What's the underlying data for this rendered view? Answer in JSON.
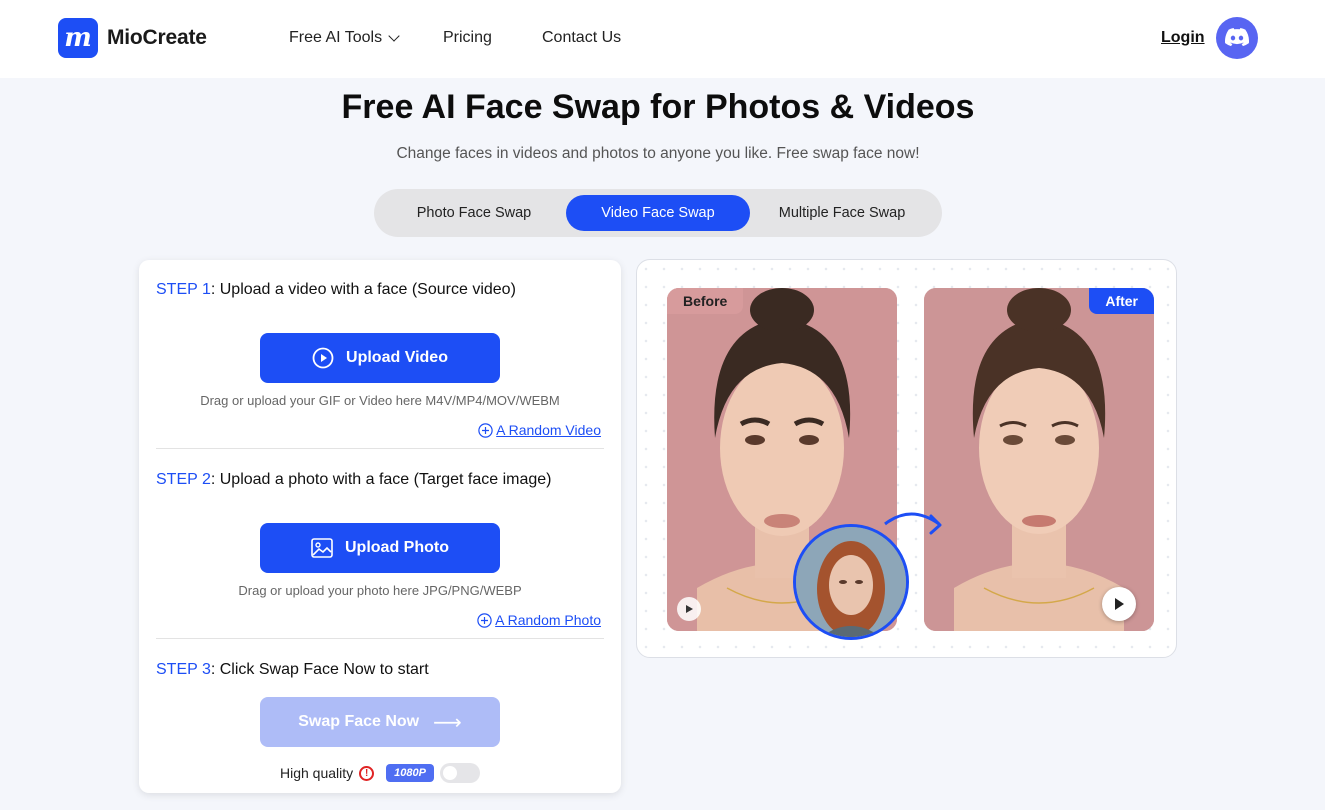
{
  "header": {
    "brand": "MioCreate",
    "logo_letter": "m",
    "nav": [
      "Free AI Tools",
      "Pricing",
      "Contact Us"
    ],
    "login": "Login",
    "discord_icon": "discord-icon"
  },
  "hero": {
    "title": "Free AI Face Swap for Photos & Videos",
    "subtitle": "Change faces in videos and photos to anyone you like. Free swap face now!"
  },
  "tabs": {
    "items": [
      "Photo Face Swap",
      "Video Face Swap",
      "Multiple Face Swap"
    ],
    "active": "Video Face Swap"
  },
  "panel": {
    "step1": {
      "num": "STEP 1",
      "text": ": Upload a video with a face (Source video)",
      "button": "Upload Video",
      "hint": "Drag or upload your GIF or Video here M4V/MP4/MOV/WEBM",
      "random": "A Random Video"
    },
    "step2": {
      "num": "STEP 2",
      "text": ": Upload a photo with a face (Target face image)",
      "button": "Upload Photo",
      "hint": "Drag or upload your photo here JPG/PNG/WEBP",
      "random": "A Random Photo"
    },
    "step3": {
      "num": "STEP 3",
      "text": ": Click Swap Face Now to start",
      "button": "Swap Face Now",
      "quality_label": "High quality",
      "quality_badge": "1080P",
      "quality_enabled": false
    }
  },
  "preview": {
    "before_label": "Before",
    "after_label": "After"
  },
  "colors": {
    "accent": "#1d4ef5",
    "disabled": "#aebcf7",
    "discord": "#5865f2"
  }
}
